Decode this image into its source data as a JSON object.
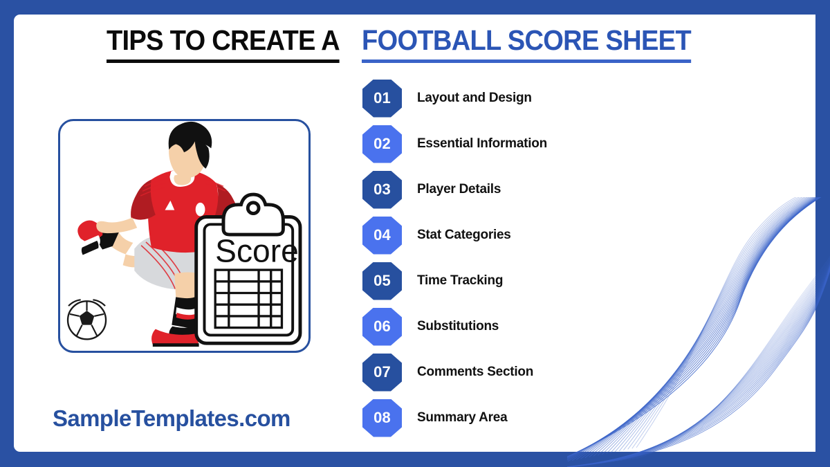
{
  "page": {
    "border_color": "#2a51a3",
    "background": "#ffffff"
  },
  "header": {
    "title_part1": "TIPS TO CREATE A",
    "title_part2": "FOOTBALL SCORE SHEET",
    "title_part1_color": "#0b0b0b",
    "title_part2_color": "#2b55b5"
  },
  "illustration": {
    "alt": "football-player-with-score-clipboard",
    "clipboard_label": "Score",
    "jersey_color": "#e0222a",
    "sleeve_color": "#b01c22",
    "shorts_color": "#d7d9dc",
    "skin_color": "#f5d0a9",
    "hair_color": "#111111",
    "shoe_color": "#e0222a",
    "sock_color": "#111111",
    "card_border_color": "#27509f"
  },
  "brand": {
    "text": "SampleTemplates.com",
    "color": "#27509f"
  },
  "tips": {
    "badge_dark": "#27509f",
    "badge_light": "#4a72ee",
    "items": [
      {
        "number": "01",
        "label": "Layout and Design",
        "tone": "dark"
      },
      {
        "number": "02",
        "label": "Essential Information",
        "tone": "light"
      },
      {
        "number": "03",
        "label": "Player Details",
        "tone": "dark"
      },
      {
        "number": "04",
        "label": "Stat Categories",
        "tone": "light"
      },
      {
        "number": "05",
        "label": "Time Tracking",
        "tone": "dark"
      },
      {
        "number": "06",
        "label": "Substitutions",
        "tone": "light"
      },
      {
        "number": "07",
        "label": "Comments Section",
        "tone": "dark"
      },
      {
        "number": "08",
        "label": "Summary Area",
        "tone": "light"
      }
    ]
  },
  "decoration": {
    "name": "flowing-wave-lines",
    "color": "#3a63c8",
    "line_count": 22
  }
}
